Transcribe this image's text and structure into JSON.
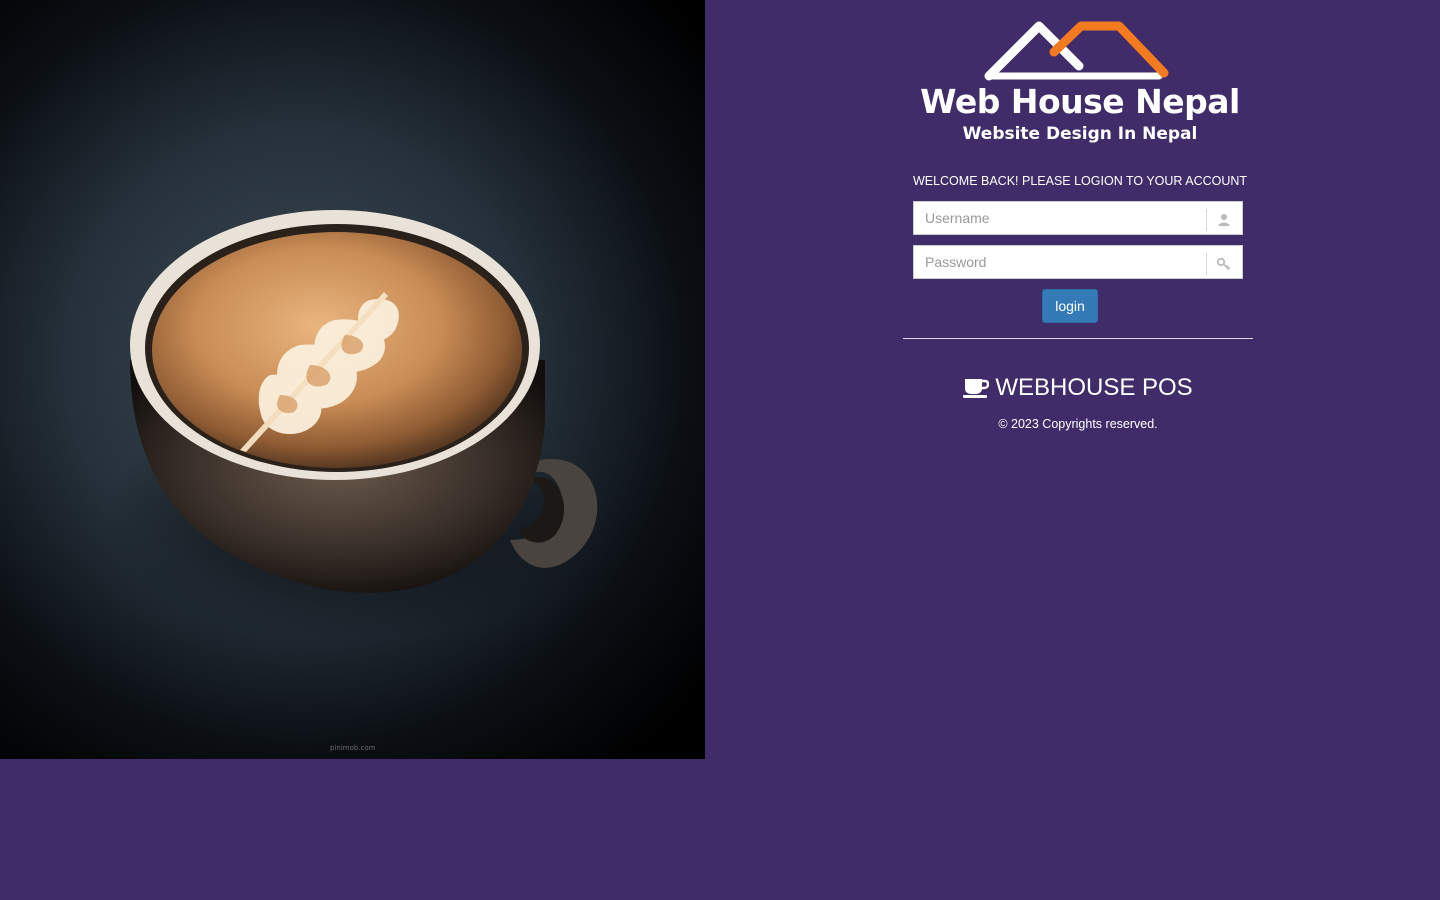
{
  "photo": {
    "alt": "latte art coffee cup",
    "credit": "pinimob.com"
  },
  "logo": {
    "brand": "Web House Nepal",
    "tagline": "Website Design In Nepal",
    "roof_colors": [
      "#ffffff",
      "#f47a20"
    ]
  },
  "login": {
    "welcome_text": "WELCOME BACK! PLEASE LOGION TO YOUR ACCOUNT",
    "username_placeholder": "Username",
    "username_value": "",
    "username_icon": "user-icon",
    "password_placeholder": "Password",
    "password_value": "",
    "password_icon": "key-icon",
    "submit_label": "login"
  },
  "footer": {
    "app_name": "WEBHOUSE POS",
    "app_icon": "coffee-cup-icon",
    "copyright": "© 2023 Copyrights reserved."
  },
  "colors": {
    "background": "#402c69",
    "button": "#337ab7",
    "accent_orange": "#f47a20"
  }
}
